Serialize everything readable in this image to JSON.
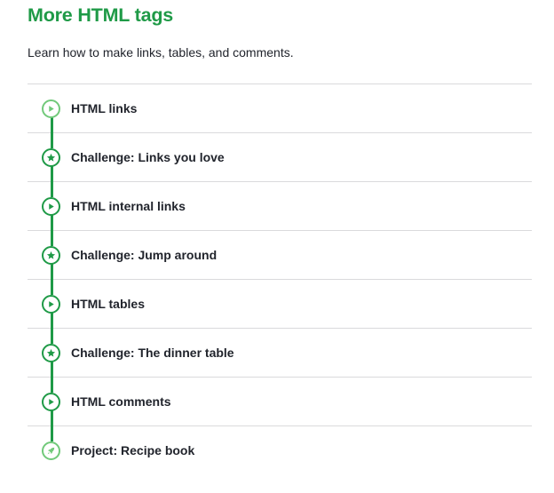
{
  "unit": {
    "title": "More HTML tags",
    "description": "Learn how to make links, tables, and comments."
  },
  "colors": {
    "accent": "#1f9a47",
    "accent_light": "#71c97a",
    "text": "#21242c",
    "divider": "#dadadc"
  },
  "lessons": [
    {
      "label": "HTML links",
      "icon": "play-icon"
    },
    {
      "label": "Challenge: Links you love",
      "icon": "star-icon"
    },
    {
      "label": "HTML internal links",
      "icon": "play-icon"
    },
    {
      "label": "Challenge: Jump around",
      "icon": "star-icon"
    },
    {
      "label": "HTML tables",
      "icon": "play-icon"
    },
    {
      "label": "Challenge: The dinner table",
      "icon": "star-icon"
    },
    {
      "label": "HTML comments",
      "icon": "play-icon"
    },
    {
      "label": "Project: Recipe book",
      "icon": "rocket-icon"
    }
  ]
}
